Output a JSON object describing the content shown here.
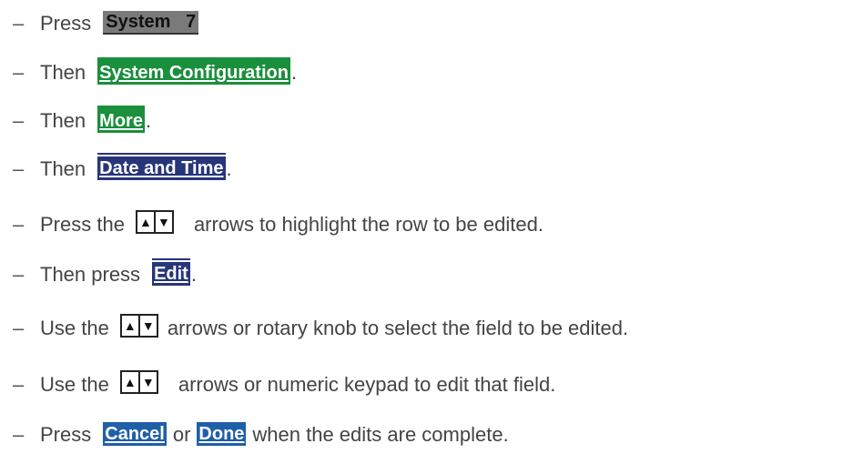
{
  "steps": [
    {
      "dash": "–",
      "text1": "Press",
      "key": "System   7"
    },
    {
      "dash": "–",
      "text1": "Then",
      "key": "System Configuration",
      "text2": "."
    },
    {
      "dash": "–",
      "text1": "Then",
      "key": "More",
      "text2": "."
    },
    {
      "dash": "–",
      "text1": "Then",
      "key": "Date and Time",
      "text2": "."
    },
    {
      "dash": "–",
      "text1": "Press the",
      "text2": "arrows to highlight the row to be edited."
    },
    {
      "dash": "–",
      "text1": "Then press",
      "key": "Edit",
      "text2": "."
    },
    {
      "dash": "–",
      "text1": "Use the",
      "text2": "arrows or rotary knob to select the field to be edited."
    },
    {
      "dash": "–",
      "text1": "Use the",
      "text2": "arrows or numeric keypad to edit that field."
    },
    {
      "dash": "–",
      "text1": "Press",
      "key": "Cancel",
      "text_mid": "or",
      "key2": "Done",
      "text2": "when the edits are complete."
    }
  ],
  "arrow_key": {
    "up": "▲",
    "down": "▼"
  },
  "colors": {
    "system_key": "#7a7a7a",
    "green_key": "#1a8f3c",
    "blue_key": "#27357a",
    "light_blue_key": "#1f5fa8"
  }
}
